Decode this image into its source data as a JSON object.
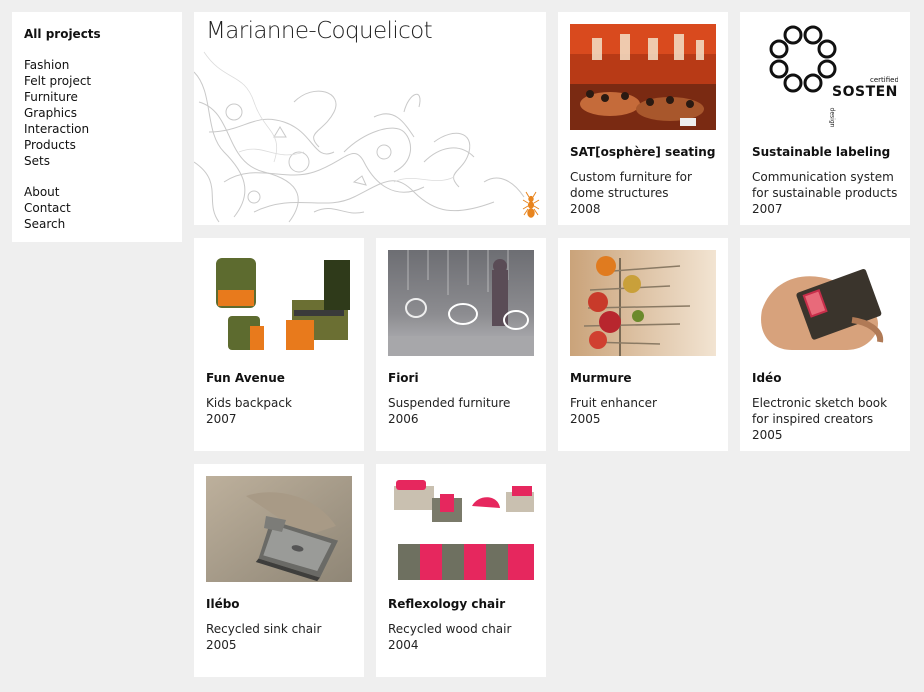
{
  "sidebar": {
    "active": "All projects",
    "categories": [
      "Fashion",
      "Felt project",
      "Furniture",
      "Graphics",
      "Interaction",
      "Products",
      "Sets"
    ],
    "links": [
      "About",
      "Contact",
      "Search"
    ]
  },
  "header": {
    "title": "Marianne-Coquelicot"
  },
  "projects": [
    {
      "title": "SAT[osphère] seating",
      "desc": "Custom furniture for dome structures",
      "year": "2008"
    },
    {
      "title": "Sustainable labeling",
      "desc": "Communication system for sustainable products",
      "year": "2007",
      "logo_text": "SOSTENIBI",
      "logo_small_1": "certified",
      "logo_small_2": "design"
    },
    {
      "title": "Fun Avenue",
      "desc": "Kids backpack",
      "year": "2007"
    },
    {
      "title": "Fiori",
      "desc": "Suspended furniture",
      "year": "2006"
    },
    {
      "title": "Murmure",
      "desc": "Fruit enhancer",
      "year": "2005"
    },
    {
      "title": "Idéo",
      "desc": "Electronic sketch book for inspired creators",
      "year": "2005"
    },
    {
      "title": "Ilébo",
      "desc": "Recycled sink chair",
      "year": "2005"
    },
    {
      "title": "Reflexology chair",
      "desc": "Recycled wood chair",
      "year": "2004"
    }
  ]
}
